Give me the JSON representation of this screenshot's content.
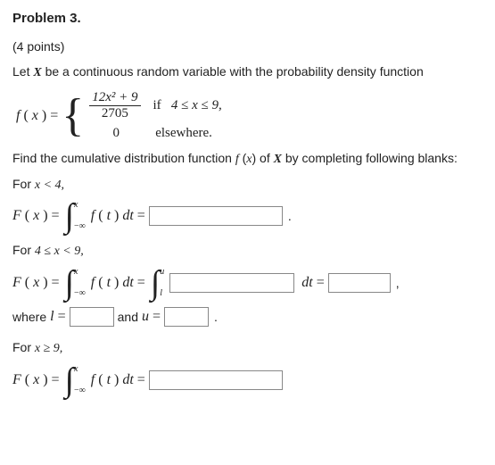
{
  "title": "Problem 3.",
  "points": "(4 points)",
  "intro_a": "Let ",
  "intro_var": "X",
  "intro_b": " be a continuous random variable with the probability density function",
  "pdf": {
    "lhs_f": "f",
    "lhs_x": "x",
    "eq": " = ",
    "num": "12x² + 9",
    "den": "2705",
    "cond1_if": "if",
    "cond1": " 4 ≤ x ≤ 9,",
    "zero": "0",
    "cond2": "elsewhere."
  },
  "find": {
    "a": "Find the cumulative distribution function ",
    "f": "f",
    "x": "x",
    "mid": " of ",
    "X": "X",
    "end": " by completing following blanks:"
  },
  "case1": {
    "for": "For ",
    "cond": "x < 4,",
    "Fxeq_F": "F",
    "Fxeq_x": "x",
    "eq": " = ",
    "int_up": "x",
    "int_lo": "−∞",
    "ft": "f",
    "t": "t",
    "dt": " dt",
    "eq2": " = "
  },
  "case2": {
    "for": "For ",
    "cond": "4 ≤ x < 9,",
    "Fxeq_F": "F",
    "Fxeq_x": "x",
    "eq": " = ",
    "int1_up": "x",
    "int1_lo": "−∞",
    "int2_up": "u",
    "int2_lo": "l",
    "ft": "f",
    "t": "t",
    "dt": " dt",
    "eq2": " = ",
    "where": "where ",
    "l": "l",
    "and": " and ",
    "u": "u"
  },
  "case3": {
    "for": "For ",
    "cond": "x ≥ 9,",
    "Fxeq_F": "F",
    "Fxeq_x": "x",
    "eq": " = ",
    "int_up": "x",
    "int_lo": "−∞",
    "ft": "f",
    "t": "t",
    "dt": " dt",
    "eq2": " = "
  },
  "period": ".",
  "comma": ","
}
